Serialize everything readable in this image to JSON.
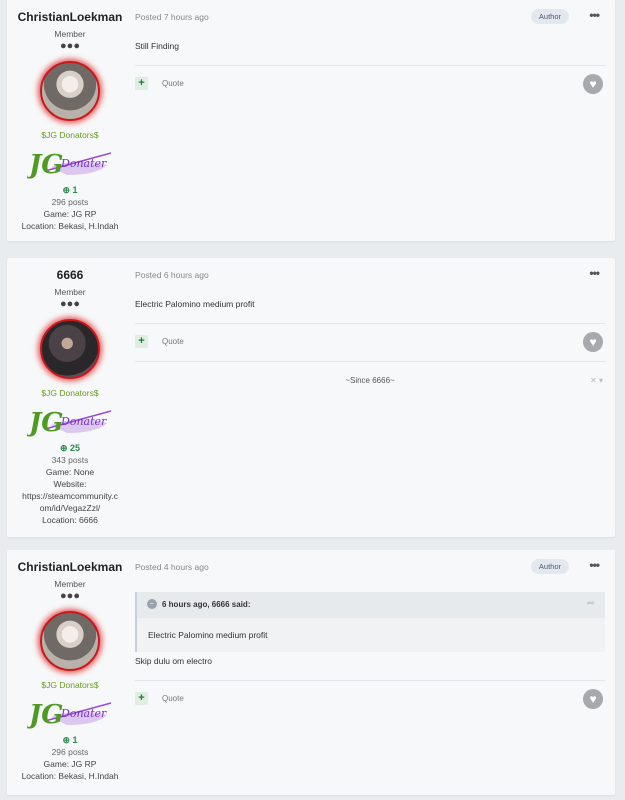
{
  "posts": [
    {
      "author": "ChristianLoekman",
      "rank": "Member",
      "rank_dots": "●●●",
      "group": "$JG Donators$",
      "badge_text_jg": "JG",
      "badge_text_donater": "Donater",
      "reputation_icon": "plus-circle-icon",
      "reputation": "1",
      "posts": "296 posts",
      "game": "Game: JG RP",
      "location": "Location: Bekasi, H.Indah",
      "date": "Posted 7 hours ago",
      "author_tag": "Author",
      "more": "•••",
      "text": "Still Finding",
      "quote_label": "Quote",
      "plus": "+",
      "like_icon": "♥"
    },
    {
      "author": "6666",
      "rank": "Member",
      "rank_dots": "●●●",
      "group": "$JG Donators$",
      "badge_text_jg": "JG",
      "badge_text_donater": "Donater",
      "reputation_icon": "plus-circle-icon",
      "reputation": "25",
      "posts": "343 posts",
      "game": "Game: None",
      "website_label": "Website:",
      "website_line1": "https://steamcommunity.c",
      "website_line2": "om/id/VegazZzl/",
      "location": "Location: 6666",
      "date": "Posted 6 hours ago",
      "more": "•••",
      "text": "Electric Palomino medium profit",
      "quote_label": "Quote",
      "plus": "+",
      "like_icon": "♥",
      "signature": "~Since 6666~",
      "signature_close": "✕ ▾"
    },
    {
      "author": "ChristianLoekman",
      "rank": "Member",
      "rank_dots": "●●●",
      "group": "$JG Donators$",
      "badge_text_jg": "JG",
      "badge_text_donater": "Donater",
      "reputation_icon": "plus-circle-icon",
      "reputation": "1",
      "posts": "296 posts",
      "game": "Game: JG RP",
      "location": "Location: Bekasi, H.Indah",
      "date": "Posted 4 hours ago",
      "author_tag": "Author",
      "more": "•••",
      "quote_citation": "6 hours ago, 6666 said:",
      "quote_text": "Electric Palomino medium profit",
      "text": "Skip dulu om electro",
      "quote_label": "Quote",
      "plus": "+",
      "like_icon": "♥"
    }
  ]
}
